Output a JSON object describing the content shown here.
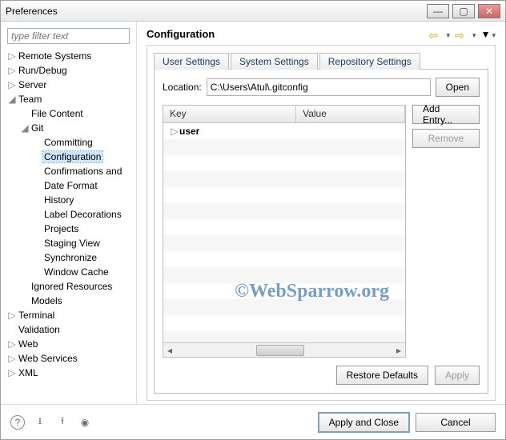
{
  "window": {
    "title": "Preferences"
  },
  "filter": {
    "placeholder": "type filter text"
  },
  "tree": [
    {
      "label": "Remote Systems",
      "depth": 0,
      "twisty": "▷"
    },
    {
      "label": "Run/Debug",
      "depth": 0,
      "twisty": "▷"
    },
    {
      "label": "Server",
      "depth": 0,
      "twisty": "▷"
    },
    {
      "label": "Team",
      "depth": 0,
      "twisty": "◢"
    },
    {
      "label": "File Content",
      "depth": 1,
      "twisty": ""
    },
    {
      "label": "Git",
      "depth": 1,
      "twisty": "◢"
    },
    {
      "label": "Committing",
      "depth": 2,
      "twisty": ""
    },
    {
      "label": "Configuration",
      "depth": 2,
      "twisty": "",
      "selected": true
    },
    {
      "label": "Confirmations and",
      "depth": 2,
      "twisty": ""
    },
    {
      "label": "Date Format",
      "depth": 2,
      "twisty": ""
    },
    {
      "label": "History",
      "depth": 2,
      "twisty": ""
    },
    {
      "label": "Label Decorations",
      "depth": 2,
      "twisty": ""
    },
    {
      "label": "Projects",
      "depth": 2,
      "twisty": ""
    },
    {
      "label": "Staging View",
      "depth": 2,
      "twisty": ""
    },
    {
      "label": "Synchronize",
      "depth": 2,
      "twisty": ""
    },
    {
      "label": "Window Cache",
      "depth": 2,
      "twisty": ""
    },
    {
      "label": "Ignored Resources",
      "depth": 1,
      "twisty": ""
    },
    {
      "label": "Models",
      "depth": 1,
      "twisty": ""
    },
    {
      "label": "Terminal",
      "depth": 0,
      "twisty": "▷"
    },
    {
      "label": "Validation",
      "depth": 0,
      "twisty": ""
    },
    {
      "label": "Web",
      "depth": 0,
      "twisty": "▷"
    },
    {
      "label": "Web Services",
      "depth": 0,
      "twisty": "▷"
    },
    {
      "label": "XML",
      "depth": 0,
      "twisty": "▷"
    }
  ],
  "page": {
    "heading": "Configuration",
    "tabs": [
      "User Settings",
      "System Settings",
      "Repository Settings"
    ],
    "active_tab": 0,
    "location_label": "Location:",
    "location_value": "C:\\Users\\Atul\\.gitconfig",
    "open_label": "Open",
    "columns": {
      "key": "Key",
      "value": "Value"
    },
    "rows": [
      {
        "key": "user",
        "value": ""
      }
    ],
    "side": {
      "add": "Add Entry...",
      "remove": "Remove"
    },
    "restore": "Restore Defaults",
    "apply": "Apply"
  },
  "footer": {
    "apply_close": "Apply and Close",
    "cancel": "Cancel"
  },
  "watermark": "©WebSparrow.org"
}
